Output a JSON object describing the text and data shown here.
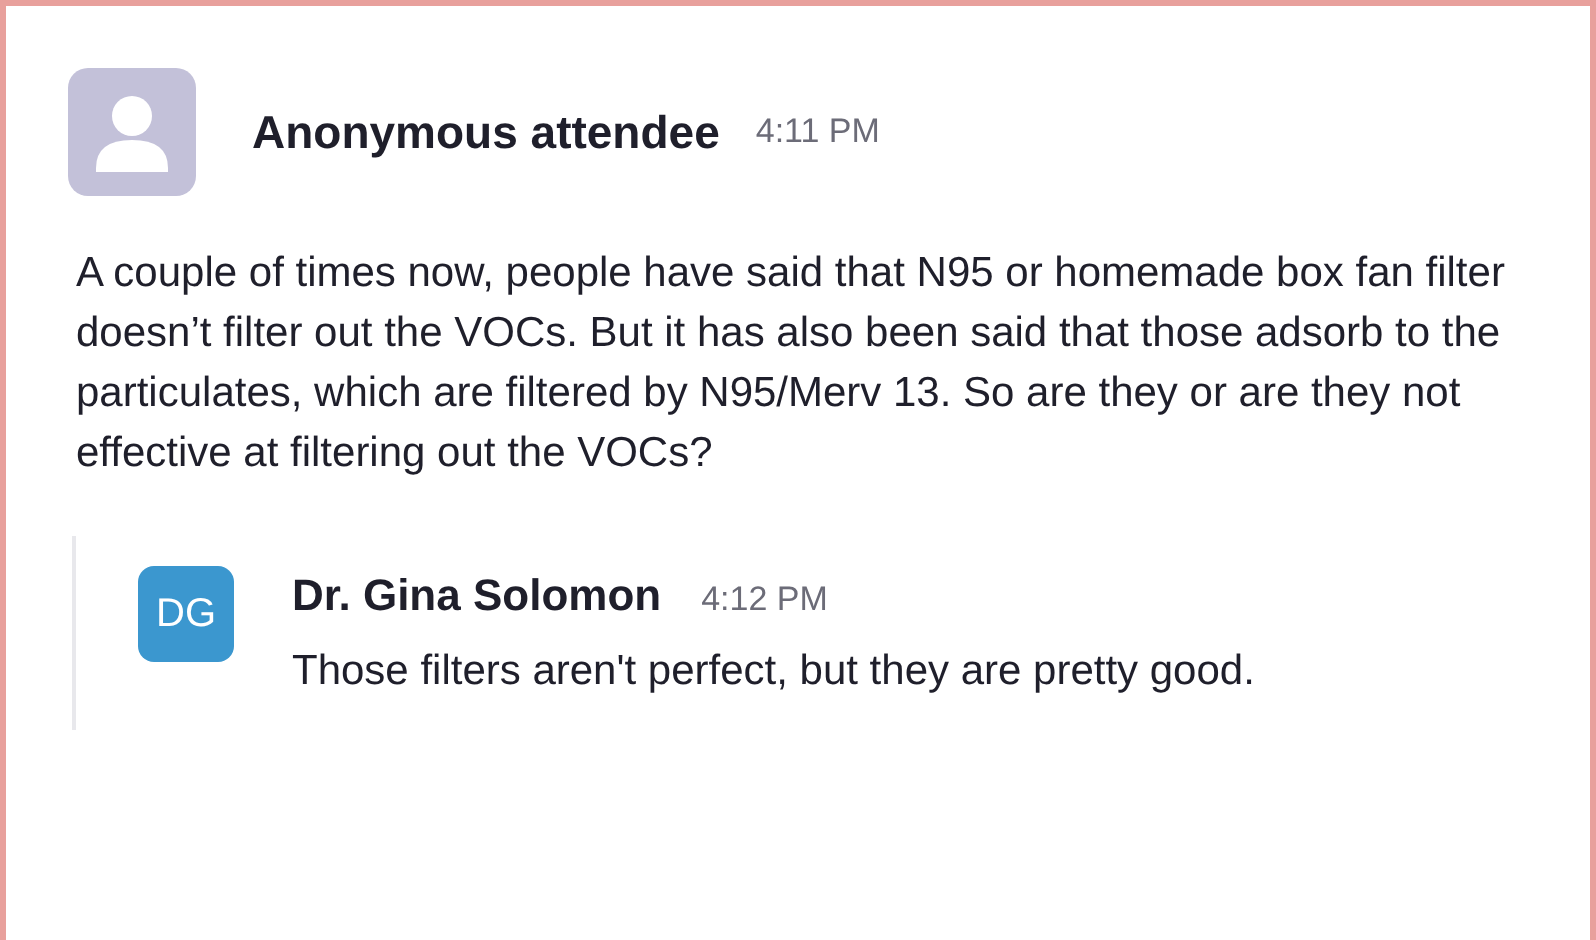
{
  "message": {
    "author": "Anonymous attendee",
    "time": "4:11 PM",
    "avatar": {
      "kind": "silhouette"
    },
    "text": "A couple of times now, people have said that N95 or homemade box fan filter doesn’t filter out the VOCs. But it has also been said that those adsorb to the particulates, which are filtered by N95/Merv 13. So are they or are they not effective at filtering out the VOCs?"
  },
  "replies": [
    {
      "author": "Dr. Gina Solomon",
      "time": "4:12 PM",
      "avatar": {
        "kind": "initials",
        "initials": "DG",
        "color": "#3b97cf"
      },
      "text": "Those filters aren't perfect, but they are pretty good."
    }
  ]
}
